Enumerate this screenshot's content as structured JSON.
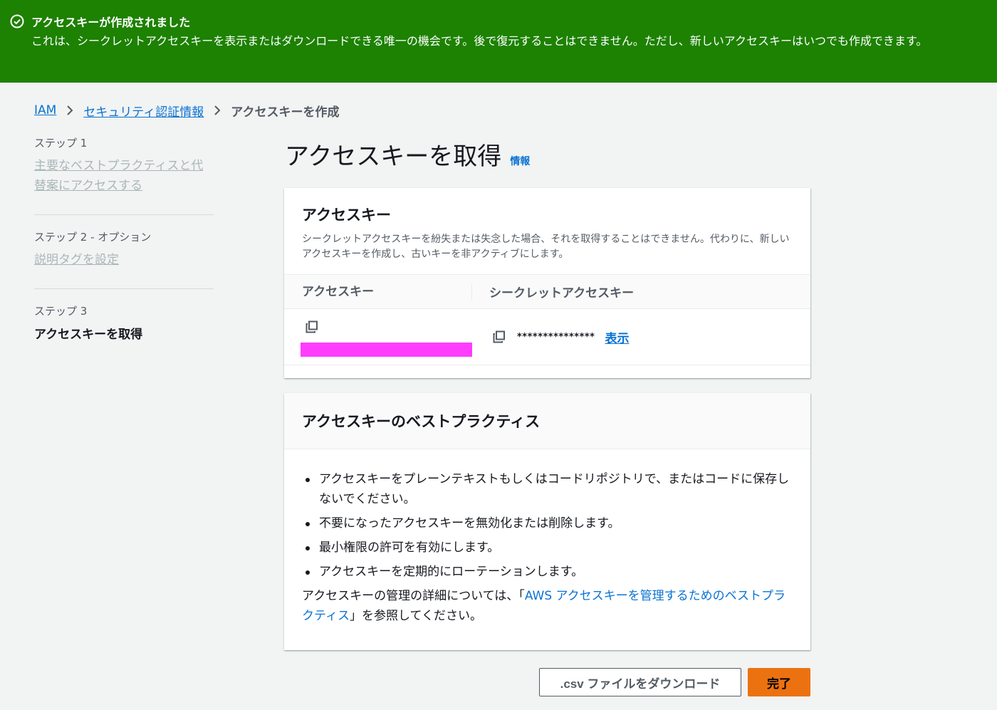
{
  "flash": {
    "title": "アクセスキーが作成されました",
    "message": "これは、シークレットアクセスキーを表示またはダウンロードできる唯一の機会です。後で復元することはできません。ただし、新しいアクセスキーはいつでも作成できます。"
  },
  "breadcrumb": {
    "items": [
      "IAM",
      "セキュリティ認証情報"
    ],
    "current": "アクセスキーを作成"
  },
  "steps": [
    {
      "label": "ステップ 1",
      "title": "主要なベストプラクティスと代替案にアクセスする"
    },
    {
      "label": "ステップ 2 - オプション",
      "title": "説明タグを設定"
    },
    {
      "label": "ステップ 3",
      "title": "アクセスキーを取得"
    }
  ],
  "page": {
    "title": "アクセスキーを取得",
    "info": "情報"
  },
  "access_key_panel": {
    "title": "アクセスキー",
    "description": "シークレットアクセスキーを紛失または失念した場合、それを取得することはできません。代わりに、新しいアクセスキーを作成し、古いキーを非アクティブにします。",
    "col_access_key": "アクセスキー",
    "col_secret_key": "シークレットアクセスキー",
    "secret_masked": "***************",
    "show_label": "表示"
  },
  "best_practices": {
    "title": "アクセスキーのベストプラクティス",
    "items": [
      "アクセスキーをプレーンテキストもしくはコードリポジトリで、またはコードに保存しないでください。",
      "不要になったアクセスキーを無効化または削除します。",
      "最小権限の許可を有効にします。",
      "アクセスキーを定期的にローテーションします。"
    ],
    "note_prefix": "アクセスキーの管理の詳細については、「",
    "note_link": "AWS アクセスキーを管理するためのベストプラクティス",
    "note_suffix": "」を参照してください。"
  },
  "buttons": {
    "download_csv": ".csv ファイルをダウンロード",
    "done": "完了"
  },
  "colors": {
    "flash_success": "#1d8102",
    "link": "#0972d3",
    "primary_button": "#ec7211",
    "redaction": "#ff3dff"
  }
}
